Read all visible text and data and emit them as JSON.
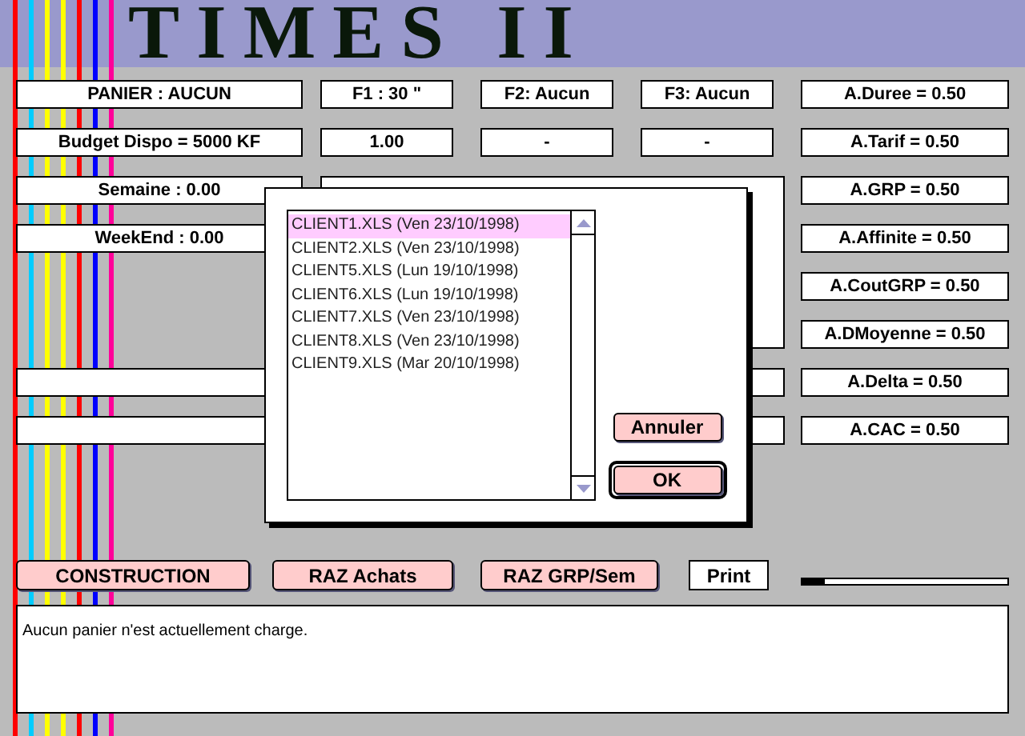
{
  "header": {
    "title": "TIMES II"
  },
  "top_rows": [
    [
      "PANIER : AUCUN",
      "F1 : 30 \"",
      "F2: Aucun",
      "F3: Aucun"
    ],
    [
      "Budget Dispo = 5000 KF",
      "1.00",
      "-",
      "-"
    ]
  ],
  "left_fields": [
    "Semaine : 0.00",
    "WeekEnd : 0.00"
  ],
  "coefficients": [
    "A.Duree = 0.50",
    "A.Tarif = 0.50",
    "A.GRP = 0.50",
    "A.Affinite = 0.50",
    "A.CoutGRP = 0.50",
    "A.DMoyenne = 0.50",
    "A.Delta = 0.50",
    "A.CAC = 0.50"
  ],
  "buttons": [
    {
      "label": "CONSTRUCTION",
      "kind": "action"
    },
    {
      "label": "RAZ Achats",
      "kind": "action"
    },
    {
      "label": "RAZ GRP/Sem",
      "kind": "action"
    },
    {
      "label": "Print",
      "kind": "plain"
    }
  ],
  "progress": {
    "level": 0.11
  },
  "message": "Aucun panier n'est actuellement charge.",
  "dialog": {
    "files": [
      {
        "label": "CLIENT1.XLS (Ven 23/10/1998)",
        "selected": true
      },
      {
        "label": "CLIENT2.XLS (Ven 23/10/1998)",
        "selected": false
      },
      {
        "label": "CLIENT5.XLS (Lun 19/10/1998)",
        "selected": false
      },
      {
        "label": "CLIENT6.XLS (Lun 19/10/1998)",
        "selected": false
      },
      {
        "label": "CLIENT7.XLS (Ven 23/10/1998)",
        "selected": false
      },
      {
        "label": "CLIENT8.XLS (Ven 23/10/1998)",
        "selected": false
      },
      {
        "label": "CLIENT9.XLS (Mar 20/10/1998)",
        "selected": false
      }
    ],
    "buttons": [
      {
        "label": "Annuler",
        "default": false
      },
      {
        "label": "OK",
        "default": true
      }
    ]
  }
}
